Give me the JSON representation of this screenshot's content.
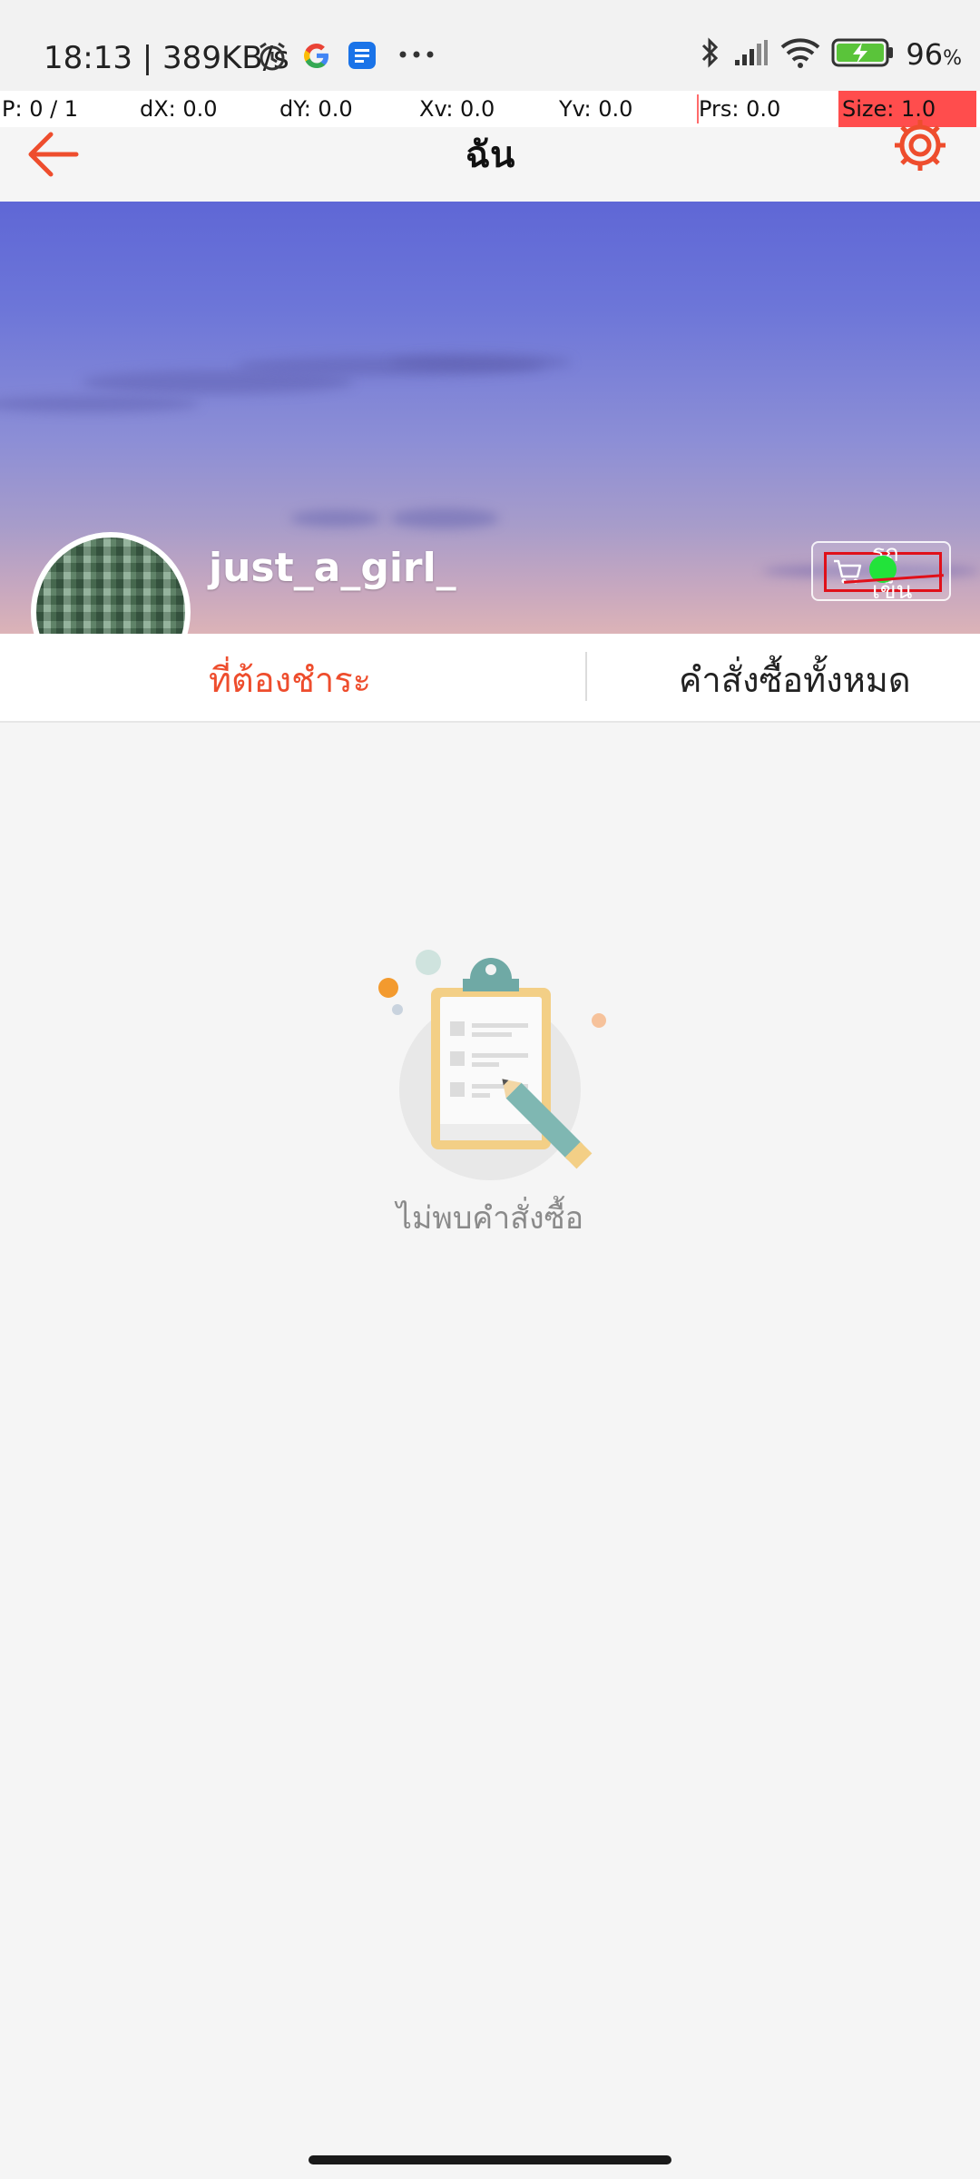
{
  "status_bar": {
    "time": "18:13 | 389KB/s",
    "battery": "96",
    "battery_unit": "%"
  },
  "debug_overlay": {
    "p": "P: 0 / 1",
    "dx": "dX: 0.0",
    "dy": "dY: 0.0",
    "xv": "Xv: 0.0",
    "yv": "Yv: 0.0",
    "prs": "Prs: 0.0",
    "size": "Size: 1.0"
  },
  "app_bar": {
    "title": "ฉัน"
  },
  "profile": {
    "username": "just_a_girl_",
    "cart_label": "รถเข็น"
  },
  "tabs": [
    {
      "label": "ที่ต้องชำระ",
      "active": true
    },
    {
      "label": "คำสั่งซื้อทั้งหมด",
      "active": false
    }
  ],
  "empty_state": {
    "message": "ไม่พบคำสั่งซื้อ"
  },
  "colors": {
    "accent": "#ee4d2d",
    "background": "#f5f5f5"
  }
}
